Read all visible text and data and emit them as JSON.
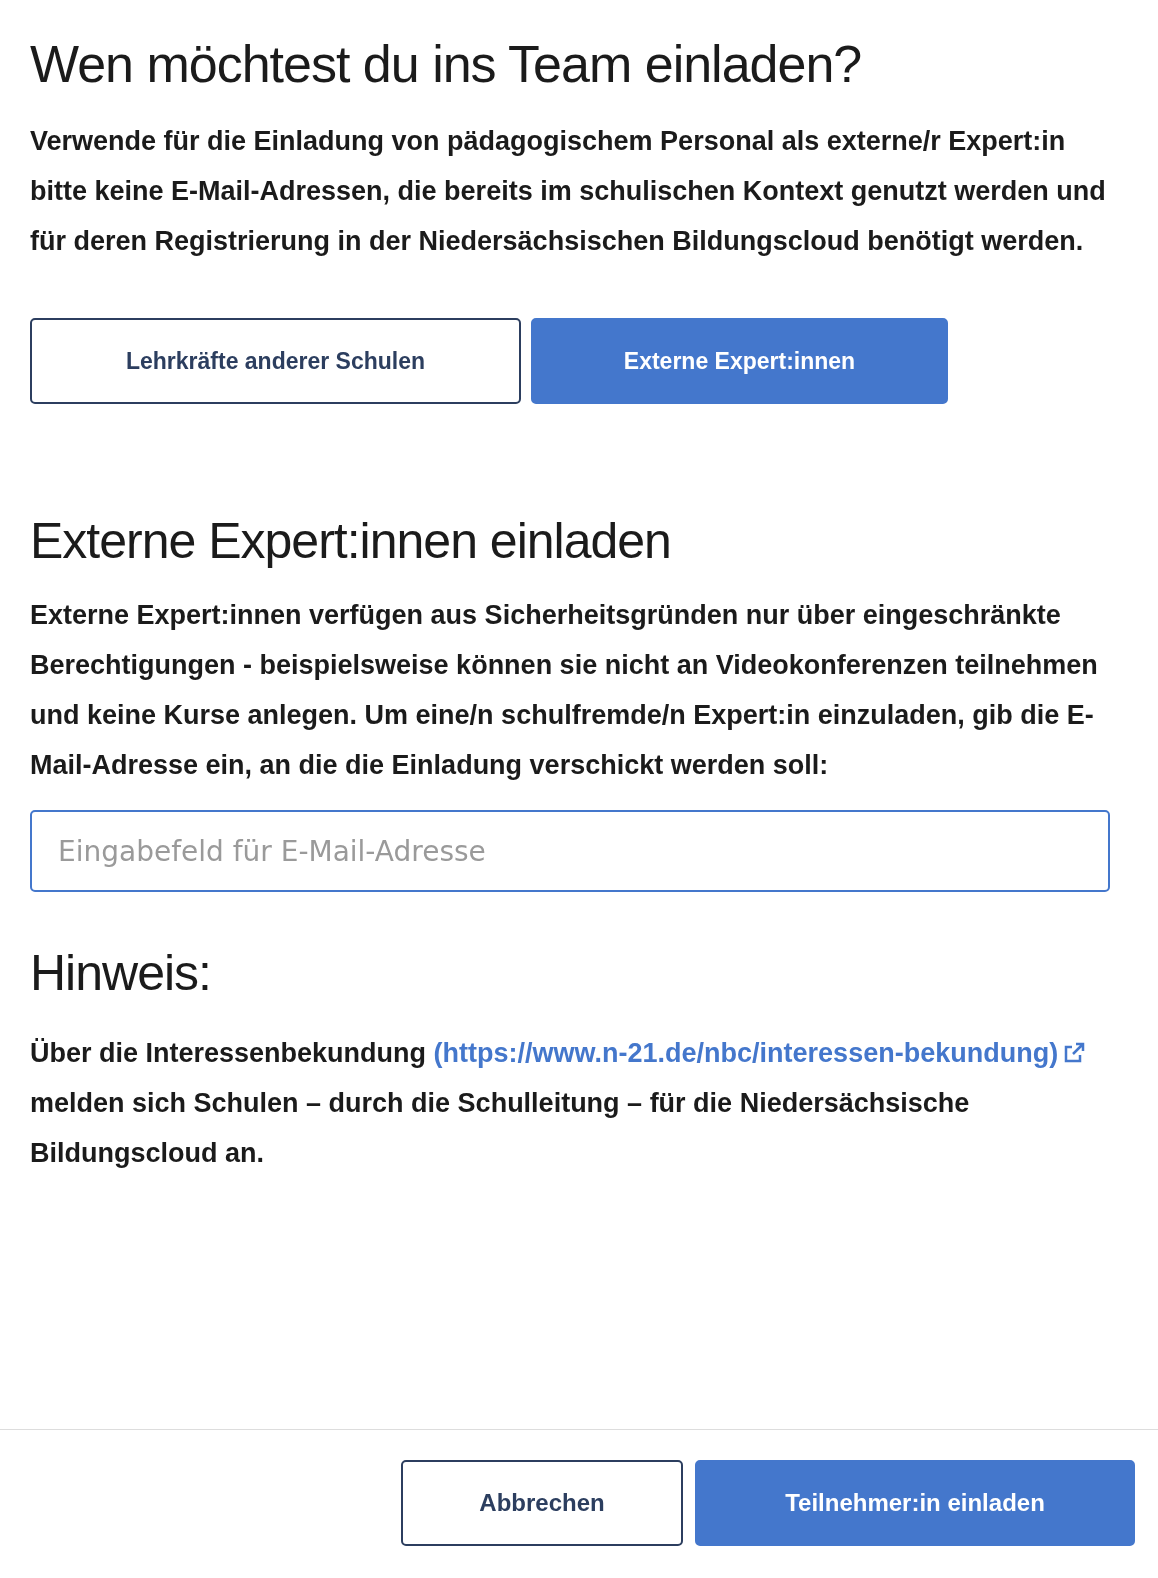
{
  "title": "Wen möchtest du ins Team einladen?",
  "intro": "Verwende für die Einladung von pädagogischem Personal als externe/r Expert:in bitte keine E-Mail-Adressen, die bereits im schulischen Kontext genutzt werden und für deren Registrierung in der Niedersächsischen Bildungscloud benötigt werden.",
  "tabs": [
    {
      "label": "Lehrkräfte anderer Schulen",
      "selected": false
    },
    {
      "label": "Externe Expert:innen",
      "selected": true
    }
  ],
  "section": {
    "heading": "Externe Expert:innen einladen",
    "text": "Externe Expert:innen verfügen aus Sicherheitsgründen nur über eingeschränkte Berechtigungen - beispielsweise können sie nicht an Videokonferenzen teilnehmen und keine Kurse anlegen. Um eine/n schulfremde/n Expert:in einzuladen, gib die E-Mail-Adresse ein, an die die Einladung verschickt werden soll:",
    "email": {
      "placeholder": "Eingabefeld für E-Mail-Adresse"
    }
  },
  "hint": {
    "heading": "Hinweis:",
    "before": "Über die Interessenbekundung",
    "link": "(https://www.n-21.de/nbc/interessen-bekundung)",
    "after": "melden sich Schulen – durch die Schulleitung – für die Niedersächsische Bildungscloud an."
  },
  "footer": {
    "buttons": [
      {
        "label": "Abbrechen",
        "kind": "secondary"
      },
      {
        "label": "Teilnehmer:in einladen",
        "kind": "primary"
      }
    ]
  }
}
